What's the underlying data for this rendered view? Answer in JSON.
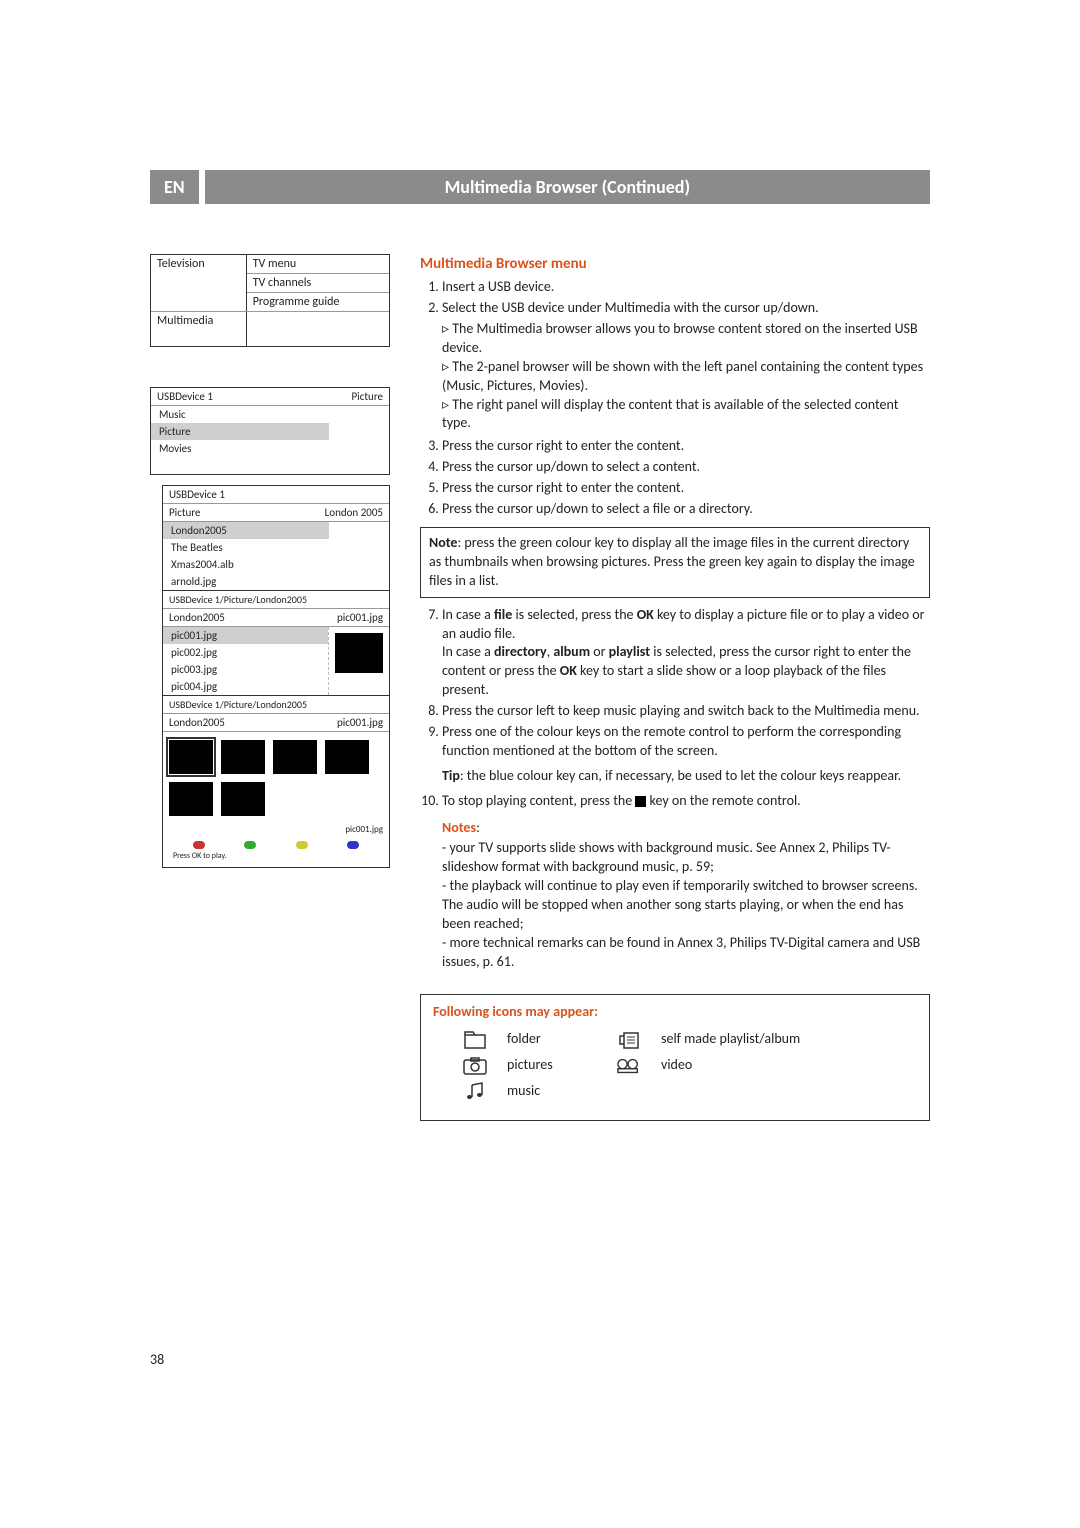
{
  "header": {
    "lang": "EN",
    "title": "Multimedia Browser   (Continued)"
  },
  "menu_box": {
    "left": [
      "Television",
      "",
      "",
      "Multimedia"
    ],
    "right": [
      "TV menu",
      "TV channels",
      "Programme guide",
      ""
    ]
  },
  "browser1": {
    "title_left": "USBDevice 1",
    "title_right": "Picture",
    "items": [
      "Music",
      "Picture",
      "Movies"
    ],
    "selected": "Picture"
  },
  "browser2": {
    "title_left": "USBDevice 1",
    "sub_left": "Picture",
    "sub_right": "London 2005",
    "items": [
      "London2005",
      "The Beatles",
      "Xmas2004.alb",
      "arnold.jpg"
    ],
    "selected": "London2005"
  },
  "browser3": {
    "path": "USBDevice 1/Picture/London2005",
    "sub_left": "London2005",
    "sub_right": "pic001.jpg",
    "items": [
      "pic001.jpg",
      "pic002.jpg",
      "pic003.jpg",
      "pic004.jpg"
    ],
    "selected": "pic001.jpg"
  },
  "browser4": {
    "path": "USBDevice 1/Picture/London2005",
    "sub_left": "London2005",
    "sub_right": "pic001.jpg",
    "thumb_label": "pic001.jpg",
    "footer": "Press OK to play."
  },
  "right": {
    "h_menu": "Multimedia Browser menu",
    "steps": {
      "s1": "Insert a USB device.",
      "s2": "Select the USB device under Multimedia with the cursor up/down.",
      "s2a": "The Multimedia browser allows you to browse content stored on the inserted USB device.",
      "s2b": "The 2-panel browser will be shown with the left panel containing the content types (Music, Pictures, Movies).",
      "s2c": "The right panel will display the content that is available of the selected content type.",
      "s3": "Press the cursor right to enter the content.",
      "s4": "Press the cursor up/down to select a content.",
      "s5": "Press the cursor right to enter the content.",
      "s6": "Press the cursor up/down to select a file or a directory.",
      "note1_b": "Note",
      "note1": ": press the green colour key to display all the image files in the current directory as thumbnails when browsing pictures. Press the green key again to display the image files in a list.",
      "s7a": "In case a ",
      "s7b": "file",
      "s7c": " is selected, press the ",
      "s7d": "OK",
      "s7e": " key to display a picture file or to play a video or an audio file.",
      "s7f": "In case a ",
      "s7g": "directory",
      "s7h": ", ",
      "s7i": "album",
      "s7j": " or ",
      "s7k": "playlist",
      "s7l": " is selected, press the cursor right to enter the content or press the ",
      "s7m": "OK",
      "s7n": " key to start a slide show or a loop playback of the files present.",
      "s8": "Press the cursor left to keep music playing and switch back to the Multimedia menu.",
      "s9": "Press one of the colour keys on the remote control to perform the corresponding function mentioned at the bottom of the screen.",
      "tip_b": "Tip",
      "tip": ": the blue colour key can, if necessary, be used to let the colour keys reappear.",
      "s10a": "To stop playing content, press the ",
      "s10b": " key on the remote control."
    },
    "notes_h": "Notes",
    "notes": {
      "n1": "your TV supports slide shows with background music. See Annex 2, Philips TV-slideshow format with background music, p. 59;",
      "n2": "the playback will continue to play even if temporarily switched to browser screens. The audio will be stopped when another song starts playing, or when the end has been reached;",
      "n3": "more technical remarks can be found in Annex 3, Philips TV-Digital camera and USB issues, p. 61."
    },
    "icons_h": "Following icons may appear:",
    "icons": {
      "folder": "folder",
      "playlist": "self made playlist/album",
      "pictures": "pictures",
      "video": "video",
      "music": "music"
    }
  },
  "page_number": "38"
}
